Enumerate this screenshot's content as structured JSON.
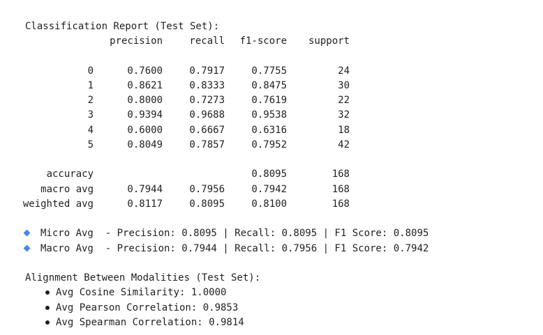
{
  "report": {
    "title": "Classification Report (Test Set):",
    "headers": [
      "precision",
      "recall",
      "f1-score",
      "support"
    ],
    "rows": [
      {
        "label": "0",
        "precision": "0.7600",
        "recall": "0.7917",
        "f1": "0.7755",
        "support": "24"
      },
      {
        "label": "1",
        "precision": "0.8621",
        "recall": "0.8333",
        "f1": "0.8475",
        "support": "30"
      },
      {
        "label": "2",
        "precision": "0.8000",
        "recall": "0.7273",
        "f1": "0.7619",
        "support": "22"
      },
      {
        "label": "3",
        "precision": "0.9394",
        "recall": "0.9688",
        "f1": "0.9538",
        "support": "32"
      },
      {
        "label": "4",
        "precision": "0.6000",
        "recall": "0.6667",
        "f1": "0.6316",
        "support": "18"
      },
      {
        "label": "5",
        "precision": "0.8049",
        "recall": "0.7857",
        "f1": "0.7952",
        "support": "42"
      }
    ],
    "summary": [
      {
        "label": "accuracy",
        "precision": "",
        "recall": "",
        "f1": "0.8095",
        "support": "168"
      },
      {
        "label": "macro avg",
        "precision": "0.7944",
        "recall": "0.7956",
        "f1": "0.7942",
        "support": "168"
      },
      {
        "label": "weighted avg",
        "precision": "0.8117",
        "recall": "0.8095",
        "f1": "0.8100",
        "support": "168"
      }
    ]
  },
  "averages": [
    {
      "text": "Micro Avg  - Precision: 0.8095 | Recall: 0.8095 | F1 Score: 0.8095",
      "icon": "blue-diamond-icon"
    },
    {
      "text": "Macro Avg  - Precision: 0.7944 | Recall: 0.7956 | F1 Score: 0.7942",
      "icon": "blue-diamond-icon"
    }
  ],
  "alignment": {
    "title": "Alignment Between Modalities (Test Set):",
    "items": [
      "Avg Cosine Similarity: 1.0000",
      "Avg Pearson Correlation: 0.9853",
      "Avg Spearman Correlation: 0.9814"
    ]
  },
  "colors": {
    "text": "#1f1f1f",
    "accent": "#4a86e8",
    "background": "#ffffff"
  }
}
